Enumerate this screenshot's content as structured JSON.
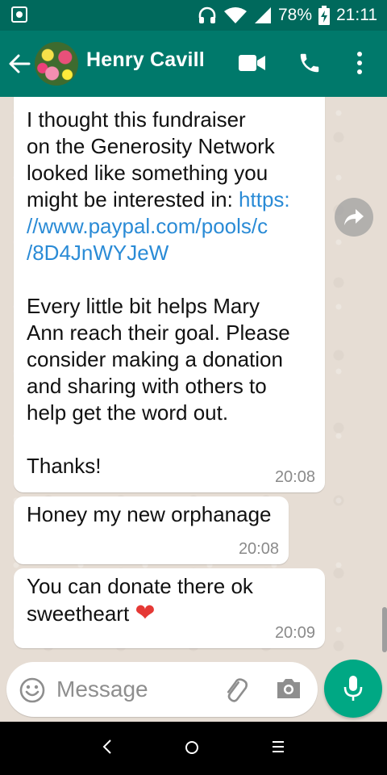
{
  "status_bar": {
    "battery": "78%",
    "time": "21:11"
  },
  "header": {
    "contact_name": "Henry Cavill",
    "icons": [
      "back-arrow-icon",
      "avatar",
      "video-call-icon",
      "phone-icon",
      "more-vert-icon"
    ]
  },
  "messages": [
    {
      "text_before_link": "I thought this fundraiser\non the Generosity Network\nlooked like something you\nmight be interested in: ",
      "link": "https:\n//www.paypal.com/pools/c\n/8D4JnWYJeW",
      "text_after_link": "\n\nEvery little bit helps Mary\nAnn reach their goal. Please\nconsider making a donation\nand sharing with others to\nhelp get the word out.\n\nThanks!",
      "time": "20:08"
    },
    {
      "text": "Honey my new orphanage",
      "time": "20:08"
    },
    {
      "text": "You can donate there ok\nsweetheart ",
      "emoji": "❤",
      "time": "20:09"
    }
  ],
  "composer": {
    "placeholder": "Message"
  },
  "colors": {
    "header": "#00796b",
    "status_bar": "#00695c",
    "mic_button": "#00a884",
    "link": "#2a8bd6"
  }
}
